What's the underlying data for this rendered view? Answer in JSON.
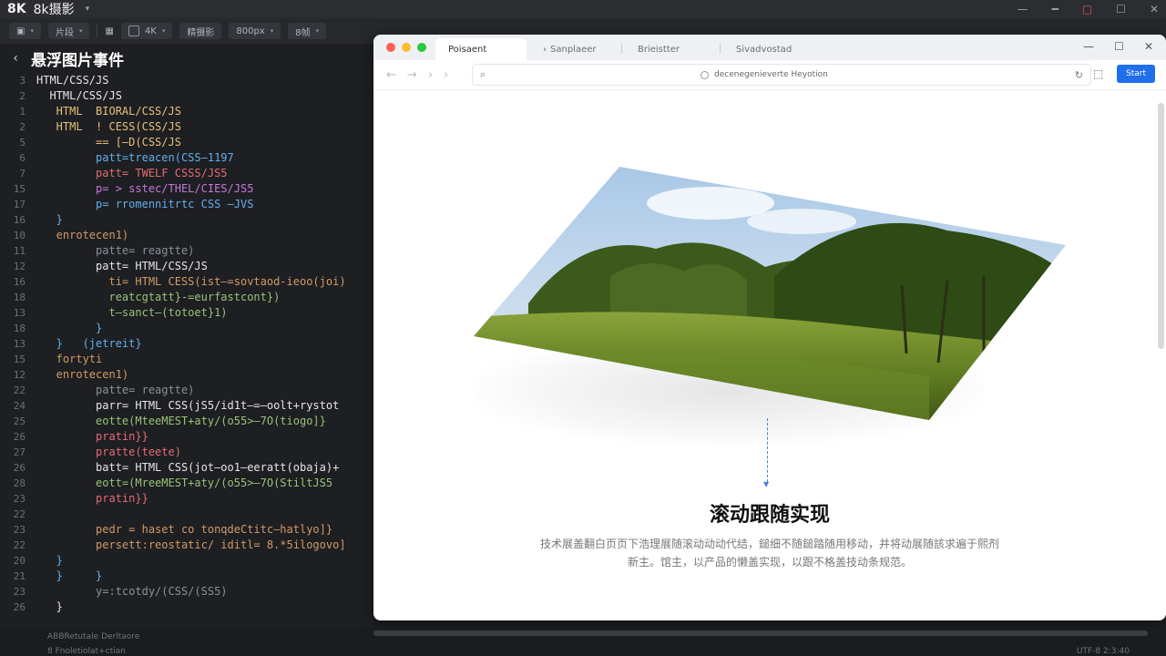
{
  "app": {
    "logo": "8K",
    "name": "8k摄影"
  },
  "toolbar": {
    "chip1": "片段",
    "resolution": "4K",
    "mode": "精摄影",
    "size": "800px",
    "chip4": "8帧"
  },
  "editor": {
    "title": "悬浮图片事件",
    "lines": [
      {
        "n": "3",
        "t": "HTML/CSS/JS",
        "c": "c-white"
      },
      {
        "n": "2",
        "t": "  HTML/CSS/JS",
        "c": "c-white"
      },
      {
        "n": "1",
        "t": "   HTML  BIORAL/CSS/JS",
        "c": "c-yellow"
      },
      {
        "n": "2",
        "t": "   HTML  ! CESS(CSS/JS",
        "c": "c-yellow"
      },
      {
        "n": "5",
        "t": "         == [—D(CSS/JS",
        "c": "c-yellow"
      },
      {
        "n": "6",
        "t": "         patt=treacen(CSS—1197",
        "c": "c-blue"
      },
      {
        "n": "7",
        "t": "         patt= TWELF CSSS/JS5",
        "c": "c-pink"
      },
      {
        "n": "15",
        "t": "         p= > sstec/THEL/CIES/JS5",
        "c": "c-purple"
      },
      {
        "n": "17",
        "t": "         p= rromennitrtc CSS —JVS",
        "c": "c-blue"
      },
      {
        "n": "16",
        "t": "   }",
        "c": "c-blue"
      },
      {
        "n": "10",
        "t": "   enrotecen1)",
        "c": "c-orange"
      },
      {
        "n": "11",
        "t": "         patte= reagtte)",
        "c": "c-dim"
      },
      {
        "n": "12",
        "t": "         patt= HTML/CSS/JS",
        "c": "c-white"
      },
      {
        "n": "16",
        "t": "           ti= HTML CESS(ist—=sovtaod-ieoo(joi)",
        "c": "c-orange"
      },
      {
        "n": "18",
        "t": "           reatcgtatt}-=eurfastcont})",
        "c": "c-green"
      },
      {
        "n": "13",
        "t": "           t—sanct—(totoet}1)",
        "c": "c-green"
      },
      {
        "n": "18",
        "t": "         }",
        "c": "c-blue"
      },
      {
        "n": "13",
        "t": "   }   (jetreit}",
        "c": "c-blue"
      },
      {
        "n": "15",
        "t": "   fortyti",
        "c": "c-orange"
      },
      {
        "n": "12",
        "t": "   enrotecen1)",
        "c": "c-orange"
      },
      {
        "n": "22",
        "t": "         patte= reagtte)",
        "c": "c-dim"
      },
      {
        "n": "24",
        "t": "         parr= HTML CSS(jS5/id1t—=—oolt+rystot",
        "c": "c-white"
      },
      {
        "n": "25",
        "t": "         eotte(MteeMEST+aty/(o55>—7O(tiogo]}",
        "c": "c-green"
      },
      {
        "n": "26",
        "t": "         pratin}}",
        "c": "c-pink"
      },
      {
        "n": "27",
        "t": "         pratte(teete)",
        "c": "c-pink"
      },
      {
        "n": "26",
        "t": "         batt= HTML CSS(jot—oo1—eeratt(obaja)+",
        "c": "c-white"
      },
      {
        "n": "28",
        "t": "         eott=(MreeMEST+aty/(o55>—7O(StiltJS5",
        "c": "c-green"
      },
      {
        "n": "23",
        "t": "         pratin}}",
        "c": "c-pink"
      },
      {
        "n": "22",
        "t": "",
        "c": "c-dim"
      },
      {
        "n": "23",
        "t": "         pedr = haset co tonqdeCtitc—hatlyo]}",
        "c": "c-orange"
      },
      {
        "n": "22",
        "t": "         persett:reostatic/ iditl= 8.*5ilogovo]",
        "c": "c-orange"
      },
      {
        "n": "20",
        "t": "   }",
        "c": "c-blue"
      },
      {
        "n": "21",
        "t": "   }     }",
        "c": "c-blue"
      },
      {
        "n": "23",
        "t": "         y=:tcotdy/(CSS/(SS5)",
        "c": "c-dim"
      },
      {
        "n": "26",
        "t": "   }",
        "c": "c-white"
      }
    ]
  },
  "status": {
    "left": "ABBRetutale  Derltaore",
    "left2": "8    Fnoletiolat+ctian",
    "right": "UTF-8    2:3:40"
  },
  "browser": {
    "tabs": [
      "Poisaent",
      "Sanplaeer",
      "Brieistter",
      "Sivadvostad"
    ],
    "url": "decenegenieverte Heyotion",
    "start_label": "Start",
    "section_title": "滚动跟随实现",
    "section_desc": "技术展盖翻白页页下浩理展随滚动动动代结，鎚细不随鎚踏随用移动，并将动展随該求遍于熙剂新主。馆主，以产品的懒盖实现，以跟不格盖技动条规范。"
  }
}
